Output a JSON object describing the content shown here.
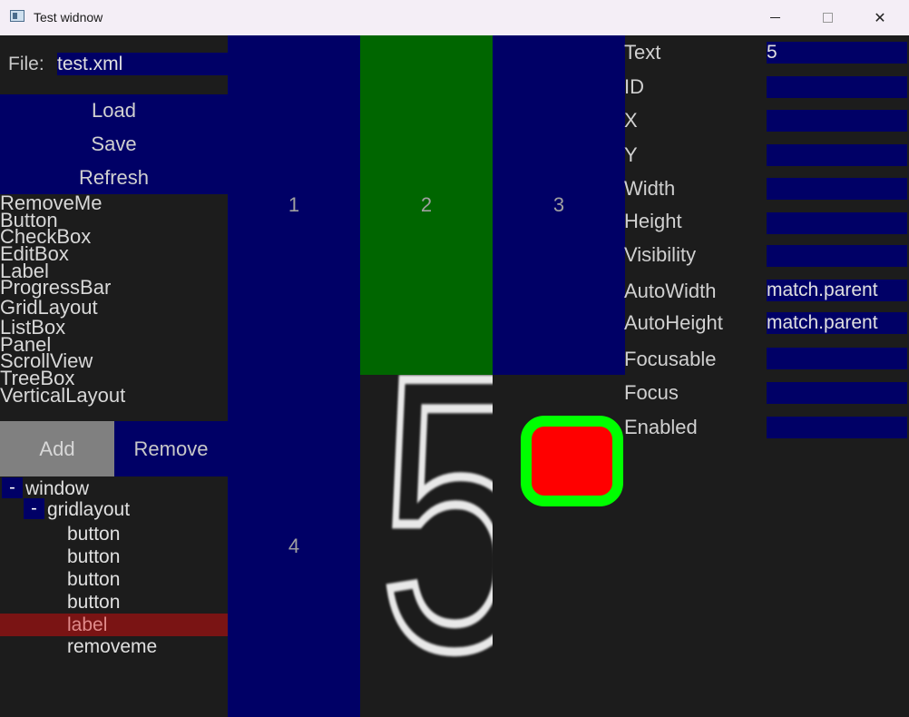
{
  "window": {
    "title": "Test widnow",
    "minimize_icon": "minimize-icon",
    "maximize_icon": "maximize-icon",
    "close_label": "✕"
  },
  "file": {
    "label": "File:",
    "value": "test.xml"
  },
  "actions": {
    "load": "Load",
    "save": "Save",
    "refresh": "Refresh"
  },
  "widget_types": [
    "RemoveMe",
    "Button",
    "CheckBox",
    "EditBox",
    "Label",
    "ProgressBar",
    "GridLayout",
    "ListBox",
    "Panel",
    "ScrollView",
    "TreeBox",
    "VerticalLayout"
  ],
  "list_buttons": {
    "add": "Add",
    "remove": "Remove"
  },
  "tree": {
    "root": {
      "toggle": "-",
      "label": "window"
    },
    "child": {
      "toggle": "-",
      "label": "gridlayout"
    },
    "items": [
      "button",
      "button",
      "button",
      "button",
      "label",
      "removeme"
    ],
    "selected_index": 4
  },
  "grid": {
    "cells": [
      "1",
      "2",
      "3",
      "4"
    ],
    "label_text": "5",
    "colors": {
      "navy": "#000066",
      "green": "#006600",
      "checkbox_border": "#00ff00",
      "checkbox_fill": "#ff0000"
    }
  },
  "properties": [
    {
      "label": "Text",
      "value": "5"
    },
    {
      "label": "ID",
      "value": ""
    },
    {
      "label": "X",
      "value": ""
    },
    {
      "label": "Y",
      "value": ""
    },
    {
      "label": "Width",
      "value": ""
    },
    {
      "label": "Height",
      "value": ""
    },
    {
      "label": "Visibility",
      "value": ""
    },
    {
      "label": "AutoWidth",
      "value": "match.parent"
    },
    {
      "label": "AutoHeight",
      "value": "match.parent"
    },
    {
      "label": "Focusable",
      "value": ""
    },
    {
      "label": "Focus",
      "value": ""
    },
    {
      "label": "Enabled",
      "value": ""
    }
  ]
}
